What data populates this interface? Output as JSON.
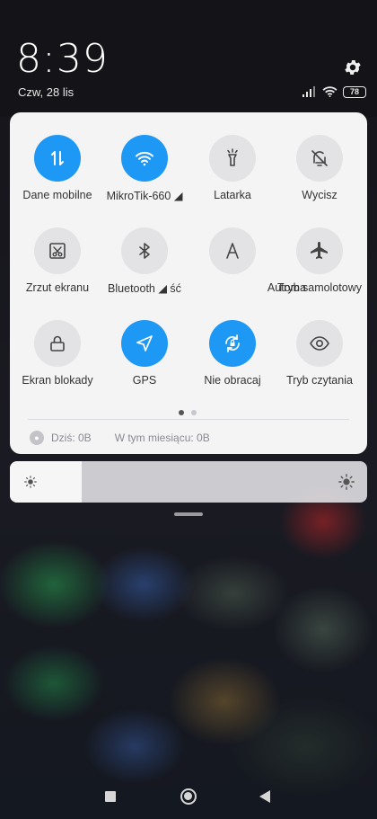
{
  "status": {
    "time": "8:39",
    "date": "Czw, 28 lis",
    "battery": "78"
  },
  "tiles": [
    {
      "label": "Dane mobilne",
      "icon": "data-transfer-icon",
      "active": true
    },
    {
      "label": "MikroTik-660",
      "icon": "wifi-icon",
      "active": true
    },
    {
      "label": "Latarka",
      "icon": "flashlight-icon",
      "active": false
    },
    {
      "label": "Wycisz",
      "icon": "bell-off-icon",
      "active": false
    },
    {
      "label": "Zrzut ekranu",
      "icon": "screenshot-icon",
      "active": false
    },
    {
      "label": "Bluetooth",
      "icon": "bluetooth-icon",
      "active": false
    },
    {
      "label": "Automa",
      "icon": "auto-brightness-icon",
      "active": false
    },
    {
      "label": "Tryb samolotowy",
      "icon": "airplane-icon",
      "active": false
    },
    {
      "label": "Ekran blokady",
      "icon": "lock-icon",
      "active": false
    },
    {
      "label": "GPS",
      "icon": "location-icon",
      "active": true
    },
    {
      "label": "Nie obracaj",
      "icon": "rotation-lock-icon",
      "active": true
    },
    {
      "label": "Tryb czytania",
      "icon": "eye-icon",
      "active": false
    }
  ],
  "data_usage": {
    "today": "Dziś: 0B",
    "month": "W tym miesiącu: 0B"
  },
  "brightness": {
    "level": 0.2
  },
  "colors": {
    "accent": "#1e98f5",
    "panel": "#f4f4f5",
    "tile_off": "#e3e3e6"
  }
}
